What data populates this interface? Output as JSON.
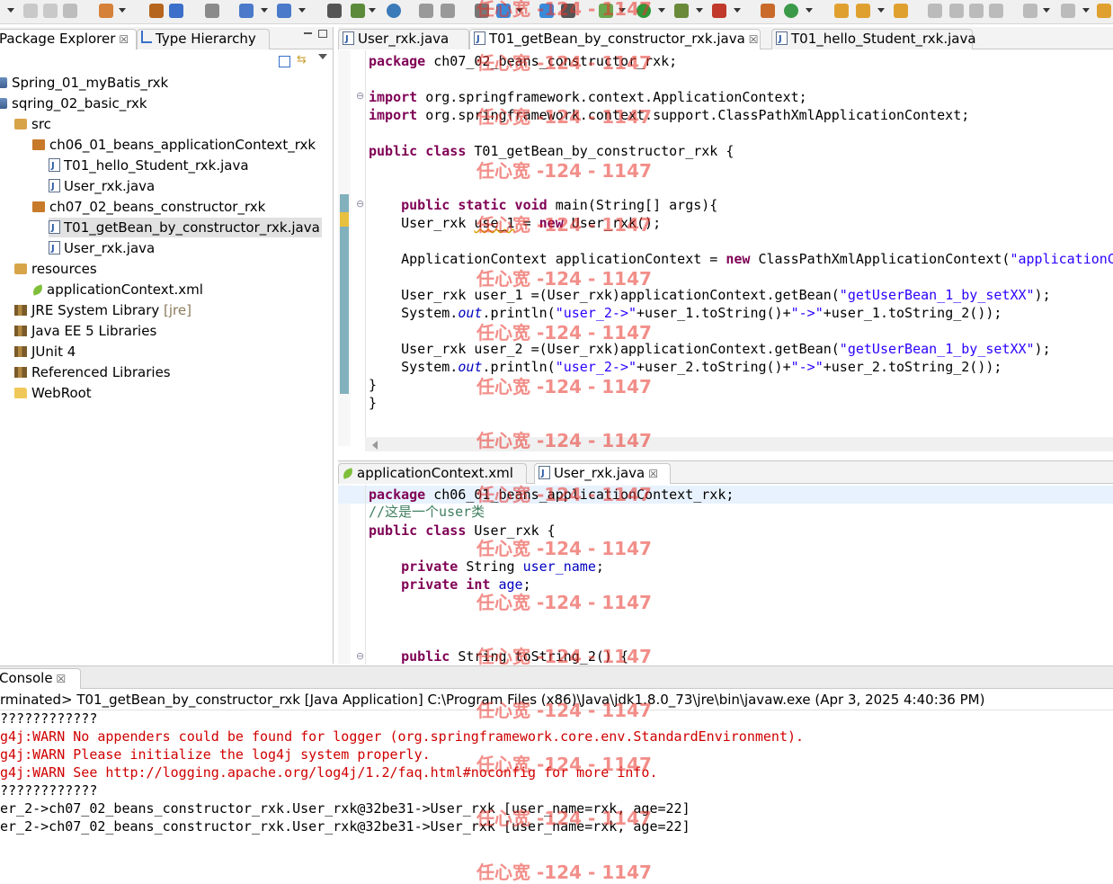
{
  "explorer": {
    "tabs": [
      {
        "label": "Package Explorer",
        "close": "☒"
      },
      {
        "label": "Type Hierarchy"
      }
    ],
    "tree": [
      {
        "label": "Spring_01_myBatis_rxk",
        "icon": "project-icon"
      },
      {
        "label": "sqring_02_basic_rxk",
        "icon": "project-icon"
      },
      {
        "label": "src",
        "icon": "source-folder-icon"
      },
      {
        "label": "ch06_01_beans_applicationContext_rxk",
        "icon": "package-icon"
      },
      {
        "label": "T01_hello_Student_rxk.java",
        "icon": "java-file-icon"
      },
      {
        "label": "User_rxk.java",
        "icon": "java-file-icon"
      },
      {
        "label": "ch07_02_beans_constructor_rxk",
        "icon": "package-icon"
      },
      {
        "label": "T01_getBean_by_constructor_rxk.java",
        "icon": "java-file-icon"
      },
      {
        "label": "User_rxk.java",
        "icon": "java-file-icon"
      },
      {
        "label": "resources",
        "icon": "source-folder-icon"
      },
      {
        "label": "applicationContext.xml",
        "icon": "xml-file-icon"
      },
      {
        "label": "JRE System Library",
        "suffix": "[jre]",
        "icon": "library-icon"
      },
      {
        "label": "Java EE 5 Libraries",
        "icon": "library-icon"
      },
      {
        "label": "JUnit 4",
        "icon": "library-icon"
      },
      {
        "label": "Referenced Libraries",
        "icon": "library-icon"
      },
      {
        "label": "WebRoot",
        "icon": "folder-icon"
      }
    ]
  },
  "editor_top": {
    "tabs": [
      {
        "label": "User_rxk.java"
      },
      {
        "label": "T01_getBean_by_constructor_rxk.java",
        "close": "☒"
      },
      {
        "label": "T01_hello_Student_rxk.java"
      }
    ],
    "code": {
      "l1_kw": "package",
      "l1_rest": " ch07_02_beans_constructor_rxk;",
      "l2_kw": "import",
      "l2_rest": " org.springframework.context.ApplicationContext;",
      "l3_kw": "import",
      "l3_rest": " org.springframework.context.support.ClassPathXmlApplicationContext;",
      "l4_kw": "public class",
      "l4_rest": " T01_getBean_by_constructor_rxk {",
      "l5_kw": "    public static void",
      "l5_rest": " main(String[] args){",
      "l6_a": "    User_rxk ",
      "l6_b": "use_1",
      "l6_c": " = ",
      "l6_kw": "new",
      "l6_d": " User_rxk();",
      "l7_a": "    ApplicationContext applicationContext = ",
      "l7_kw": "new",
      "l7_b": " ClassPathXmlApplicationContext(",
      "l7_str": "\"applicationC",
      "l8_a": "    User_rxk user_1 =(User_rxk)applicationContext.getBean(",
      "l8_str": "\"getUserBean_1_by_setXX\"",
      "l8_b": ");",
      "l9_a": "    System.",
      "l9_out": "out",
      "l9_b": ".println(",
      "l9_str1": "\"user_2->\"",
      "l9_c": "+user_1.toString()+",
      "l9_str2": "\"->\"",
      "l9_d": "+user_1.toString_2());",
      "l10_a": "    User_rxk user_2 =(User_rxk)applicationContext.getBean(",
      "l10_str": "\"getUserBean_1_by_setXX\"",
      "l10_b": ");",
      "l11_a": "    System.",
      "l11_out": "out",
      "l11_b": ".println(",
      "l11_str1": "\"user_2->\"",
      "l11_c": "+user_2.toString()+",
      "l11_str2": "\"->\"",
      "l11_d": "+user_2.toString_2());",
      "l12": "}",
      "l13": "}"
    }
  },
  "editor_bottom": {
    "tabs": [
      {
        "label": "applicationContext.xml"
      },
      {
        "label": "User_rxk.java",
        "close": "☒"
      }
    ],
    "code": {
      "l1_kw": "package",
      "l1_rest": " ch06_01_beans_applicationContext_rxk;",
      "l2": "//这是一个user类",
      "l3_kw": "public class",
      "l3_rest": " User_rxk {",
      "l4_kw": "    private",
      "l4_mid": " String ",
      "l4_fld": "user_name",
      "l4_end": ";",
      "l5_kw": "    private int",
      "l5_mid": " ",
      "l5_fld": "age",
      "l5_end": ";",
      "l6_kw": "    public",
      "l6_rest": " String toString_2() {"
    }
  },
  "console": {
    "tab": "Console",
    "close": "☒",
    "header": "rminated> T01_getBean_by_constructor_rxk [Java Application] C:\\Program Files (x86)\\Java\\jdk1.8.0_73\\jre\\bin\\javaw.exe (Apr 3, 2025 4:40:36 PM)",
    "lines": [
      {
        "text": "????????????",
        "warn": false
      },
      {
        "text": "g4j:WARN No appenders could be found for logger (org.springframework.core.env.StandardEnvironment).",
        "warn": true
      },
      {
        "text": "g4j:WARN Please initialize the log4j system properly.",
        "warn": true
      },
      {
        "text": "g4j:WARN See http://logging.apache.org/log4j/1.2/faq.html#noconfig for more info.",
        "warn": true
      },
      {
        "text": "????????????",
        "warn": false
      },
      {
        "text": "er_2->ch07_02_beans_constructor_rxk.User_rxk@32be31->User_rxk [user_name=rxk, age=22]",
        "warn": false
      },
      {
        "text": "er_2->ch07_02_beans_constructor_rxk.User_rxk@32be31->User_rxk [user_name=rxk, age=22]",
        "warn": false
      }
    ]
  },
  "watermark": "任心宽 -124 - 1147",
  "colors": {
    "keyword": "#7f0055",
    "string": "#2a00ff",
    "field": "#0000c0",
    "comment": "#3f7f5f",
    "warn": "#d00000",
    "watermark": "#e8332a"
  }
}
